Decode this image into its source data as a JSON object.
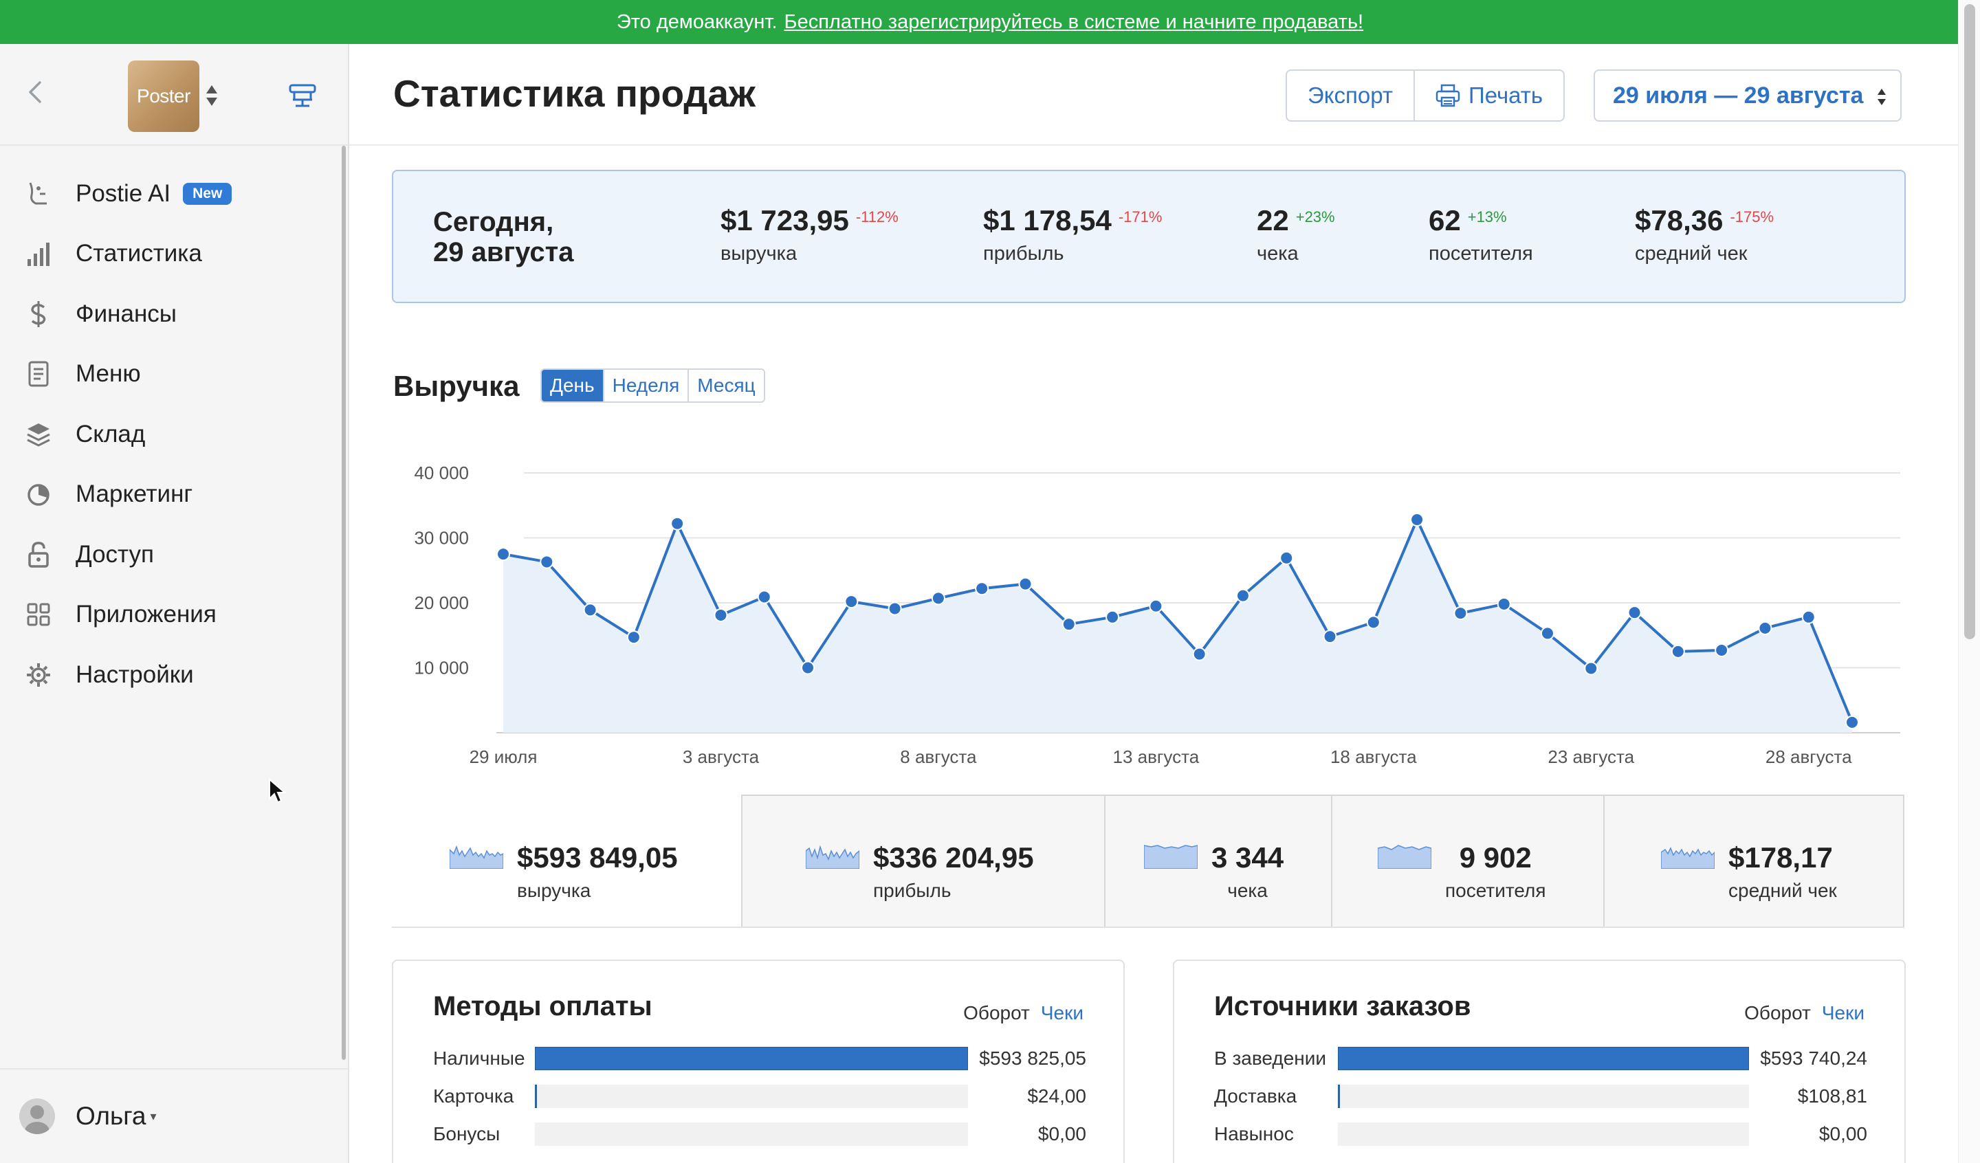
{
  "banner": {
    "text": "Это демоаккаунт.",
    "link": "Бесплатно зарегистрируйтесь в системе и начните продавать!"
  },
  "sidebar": {
    "logo_text": "Poster",
    "items": [
      {
        "label": "Postie AI",
        "badge": "New",
        "icon": "postie-ai-icon"
      },
      {
        "label": "Статистика",
        "icon": "bar-chart-icon"
      },
      {
        "label": "Финансы",
        "icon": "dollar-icon"
      },
      {
        "label": "Меню",
        "icon": "document-icon"
      },
      {
        "label": "Склад",
        "icon": "layers-icon"
      },
      {
        "label": "Маркетинг",
        "icon": "pie-chart-icon"
      },
      {
        "label": "Доступ",
        "icon": "lock-icon"
      },
      {
        "label": "Приложения",
        "icon": "apps-grid-icon"
      },
      {
        "label": "Настройки",
        "icon": "gear-icon"
      }
    ],
    "user": {
      "name": "Ольга"
    }
  },
  "header": {
    "title": "Статистика продаж",
    "export_label": "Экспорт",
    "print_label": "Печать",
    "date_range": "29 июля — 29 августа"
  },
  "today": {
    "title_line1": "Сегодня,",
    "title_line2": "29 августа",
    "kpis": [
      {
        "value": "$1 723,95",
        "delta": "-112%",
        "label": "выручка",
        "trend": "down"
      },
      {
        "value": "$1 178,54",
        "delta": "-171%",
        "label": "прибыль",
        "trend": "down"
      },
      {
        "value": "22",
        "delta": "+23%",
        "label": "чека",
        "trend": "up"
      },
      {
        "value": "62",
        "delta": "+13%",
        "label": "посетителя",
        "trend": "up"
      },
      {
        "value": "$78,36",
        "delta": "-175%",
        "label": "средний чек",
        "trend": "down"
      }
    ]
  },
  "revenue": {
    "title": "Выручка",
    "periods": [
      "День",
      "Неделя",
      "Месяц"
    ],
    "active_period": "День"
  },
  "chart_data": {
    "type": "area",
    "title": "Выручка",
    "xlabel": "",
    "ylabel": "",
    "ylim": [
      0,
      40000
    ],
    "yticks": [
      10000,
      20000,
      30000,
      40000
    ],
    "ytick_labels": [
      "10 000",
      "20 000",
      "30 000",
      "40 000"
    ],
    "xtick_labels": [
      "29 июля",
      "3 августа",
      "8 августа",
      "13 августа",
      "18 августа",
      "23 августа",
      "28 августа"
    ],
    "xtick_index": [
      0,
      5,
      10,
      15,
      20,
      25,
      30
    ],
    "grid": true,
    "color": "#2f72c4",
    "fill": "#e8f0fa",
    "x": [
      "29 июля",
      "30 июля",
      "31 июля",
      "1 августа",
      "2 августа",
      "3 августа",
      "4 августа",
      "5 августа",
      "6 августа",
      "7 августа",
      "8 августа",
      "9 августа",
      "10 августа",
      "11 августа",
      "12 августа",
      "13 августа",
      "14 августа",
      "15 августа",
      "16 августа",
      "17 августа",
      "18 августа",
      "19 августа",
      "20 августа",
      "21 августа",
      "22 августа",
      "23 августа",
      "24 августа",
      "25 августа",
      "26 августа",
      "27 августа",
      "28 августа",
      "29 августа"
    ],
    "values": [
      27500,
      26300,
      18900,
      14700,
      32200,
      18100,
      20900,
      10000,
      20200,
      19100,
      20700,
      22200,
      22900,
      16700,
      17800,
      19500,
      12100,
      21100,
      26900,
      14800,
      17000,
      32800,
      18400,
      19800,
      15300,
      9900,
      18500,
      12500,
      12700,
      16100,
      17800,
      1600
    ]
  },
  "totals": [
    {
      "value": "$593 849,05",
      "label": "выручка",
      "spark": "revenue-sparkline-icon"
    },
    {
      "value": "$336 204,95",
      "label": "прибыль",
      "spark": "profit-sparkline-icon"
    },
    {
      "value": "3 344",
      "label": "чека",
      "spark": "checks-sparkline-icon"
    },
    {
      "value": "9 902",
      "label": "посетителя",
      "spark": "visitors-sparkline-icon"
    },
    {
      "value": "$178,17",
      "label": "средний чек",
      "spark": "avg-check-sparkline-icon"
    }
  ],
  "payment_methods": {
    "title": "Методы оплаты",
    "switch": [
      "Оборот",
      "Чеки"
    ],
    "rows": [
      {
        "label": "Наличные",
        "value": "$593 825,05",
        "fraction": 1.0
      },
      {
        "label": "Карточка",
        "value": "$24,00",
        "fraction": 4e-05
      },
      {
        "label": "Бонусы",
        "value": "$0,00",
        "fraction": 0
      }
    ]
  },
  "order_sources": {
    "title": "Источники заказов",
    "switch": [
      "Оборот",
      "Чеки"
    ],
    "rows": [
      {
        "label": "В заведении",
        "value": "$593 740,24",
        "fraction": 1.0
      },
      {
        "label": "Доставка",
        "value": "$108,81",
        "fraction": 0.0002
      },
      {
        "label": "Навынос",
        "value": "$0,00",
        "fraction": 0
      }
    ]
  }
}
